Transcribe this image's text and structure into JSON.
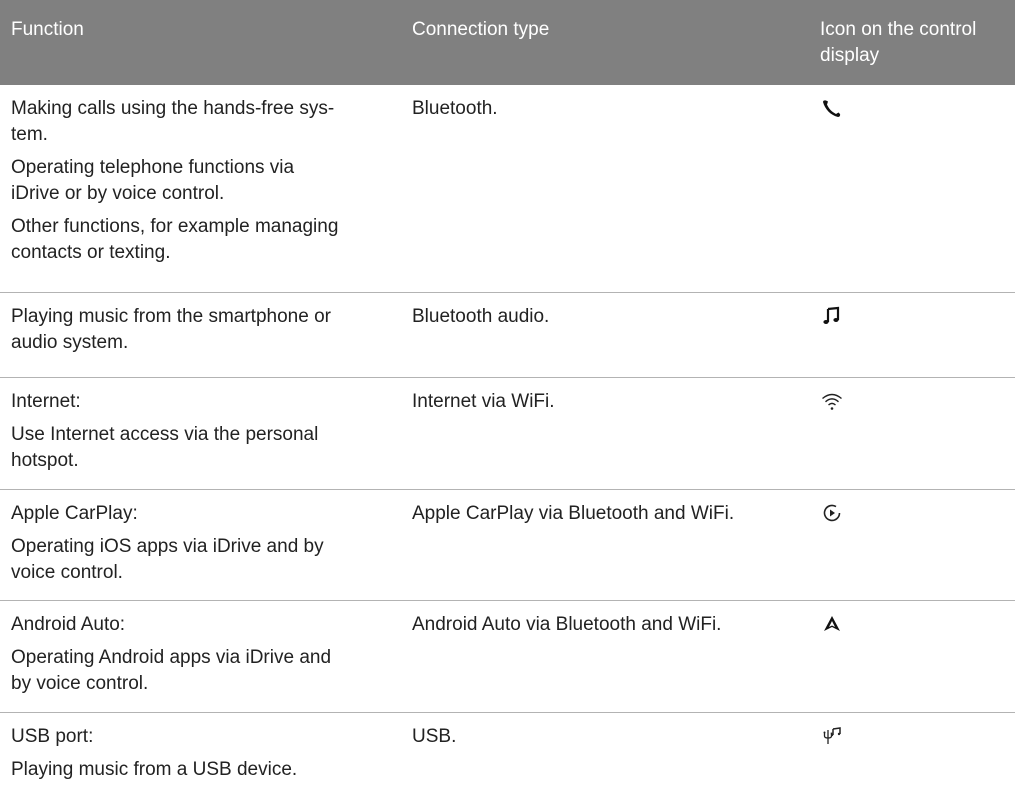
{
  "headers": {
    "function": "Function",
    "connection": "Connection type",
    "icon_line1": "Icon on the control",
    "icon_line2": "display"
  },
  "rows": [
    {
      "function": [
        "Making calls using the hands-free sys-",
        "tem.",
        "Operating telephone functions via",
        "iDrive or by voice control.",
        "Other functions, for example managing",
        "contacts or texting."
      ],
      "connection": "Bluetooth.",
      "icon": "phone-handset-icon"
    },
    {
      "function": [
        "Playing music from the smartphone or",
        "audio system."
      ],
      "connection": "Bluetooth audio.",
      "icon": "music-note-icon"
    },
    {
      "function": [
        "Internet:",
        "Use Internet access via the personal",
        "hotspot."
      ],
      "connection": "Internet via WiFi.",
      "icon": "wifi-icon"
    },
    {
      "function": [
        "Apple CarPlay:",
        "Operating iOS apps via iDrive and by",
        "voice control."
      ],
      "connection": "Apple CarPlay via Bluetooth and WiFi.",
      "icon": "carplay-play-icon"
    },
    {
      "function": [
        "Android Auto:",
        "Operating Android apps via iDrive and",
        "by voice control."
      ],
      "connection": "Android Auto via Bluetooth and WiFi.",
      "icon": "android-auto-icon"
    },
    {
      "function": [
        "USB port:",
        "Playing music from a USB device."
      ],
      "connection": "USB.",
      "icon": "usb-music-icon"
    }
  ]
}
